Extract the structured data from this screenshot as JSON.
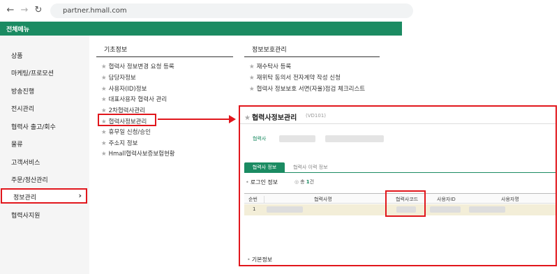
{
  "browser": {
    "back_icon": "arrow-left",
    "forward_icon": "arrow-right",
    "reload_icon": "reload",
    "url": "partner.hmall.com"
  },
  "topbar": {
    "label": "전체메뉴",
    "color": "#1b8b62"
  },
  "sidebar": {
    "items": [
      "상품",
      "마케팅/프로모션",
      "방송진행",
      "전시관리",
      "협력사 출고/회수",
      "물류",
      "고객서비스",
      "주문/정산관리",
      "정보관리",
      "협력사지원"
    ],
    "active": "정보관리",
    "active_chevron": "›"
  },
  "columns": {
    "basic": {
      "title": "기초정보",
      "items": [
        "협력사 정보변경 요청 등록",
        "담당자정보",
        "사용자(ID)정보",
        "대표사용자 협력사 관리",
        "2차협력사관리",
        "협력사정보관리",
        "휴무일 신청/승인",
        "주소지 정보",
        "Hmall협력사보증보험현황"
      ]
    },
    "privacy": {
      "title": "정보보호관리",
      "items": [
        "재수탁사 등록",
        "재위탁 동의서 전자계약 작성 신청",
        "협력사 정보보호 서면(자율)점검 체크리스트"
      ]
    }
  },
  "panel": {
    "title": "협력사정보관리",
    "code": "(VD101)",
    "partner_label": "협력사",
    "tabs": [
      "협력사 정보",
      "협력사 이력 정보"
    ],
    "login_label": "로그인 정보",
    "count_prefix": "총",
    "count_value": "1",
    "count_suffix": "건",
    "columns": [
      "순번",
      "협력사명",
      "협력사코드",
      "사용자ID",
      "사용자명"
    ],
    "rows": [
      [
        "1",
        "",
        "",
        "",
        ""
      ]
    ],
    "basic_label": "기본정보"
  },
  "colors": {
    "accent": "#1b8b62",
    "highlight": "#e1161c"
  }
}
